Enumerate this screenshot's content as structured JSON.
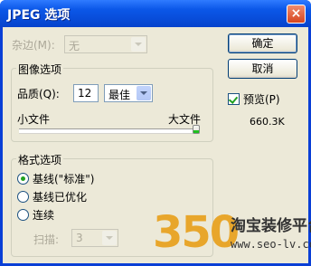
{
  "window": {
    "title": "JPEG 选项",
    "close_glyph": "×"
  },
  "matte": {
    "label": "杂边(M):",
    "value": "无"
  },
  "image_options": {
    "group_title": "图像选项",
    "quality_label": "品质(Q):",
    "quality_value": "12",
    "quality_preset": "最佳",
    "small_file_label": "小文件",
    "large_file_label": "大文件",
    "quality_level_fraction": 1.0
  },
  "buttons": {
    "ok": "确定",
    "cancel": "取消"
  },
  "preview": {
    "label": "预览(P)",
    "checked": true,
    "file_size": "660.3K"
  },
  "format_options": {
    "group_title": "格式选项",
    "options": [
      {
        "label": "基线(\"标准\")",
        "selected": true
      },
      {
        "label": "基线已优化",
        "selected": false
      },
      {
        "label": "连续",
        "selected": false
      }
    ],
    "scans_label": "扫描:",
    "scans_value": "3"
  },
  "watermark": {
    "number": "350",
    "text": "淘宝装修平台",
    "url": "www.seo-lv.com"
  }
}
